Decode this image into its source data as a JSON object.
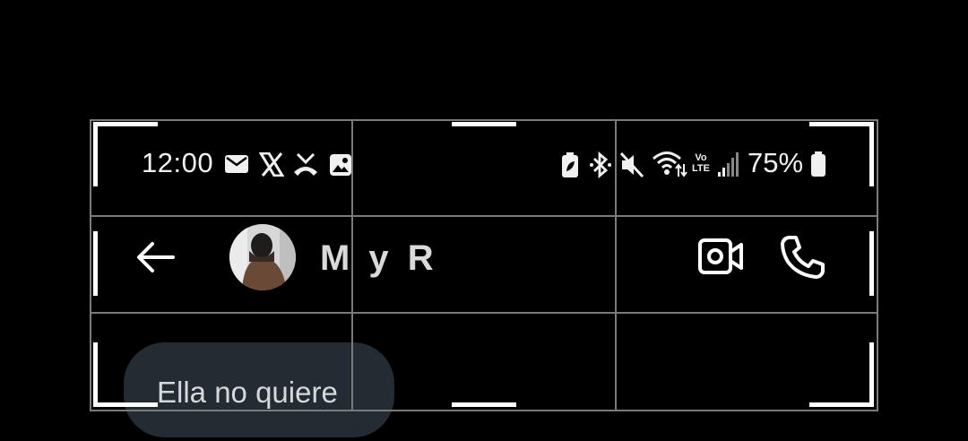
{
  "status_bar": {
    "time": "12:00",
    "battery": "75%",
    "left_icons": [
      "mail-icon",
      "x-logo-icon",
      "missed-call-icon",
      "image-icon"
    ],
    "right_icons": [
      "battery-saver-icon",
      "bluetooth-icon",
      "mute-icon",
      "wifi-icon",
      "volte-icon",
      "signal-icon",
      "battery-icon"
    ],
    "volte_top": "Vo",
    "volte_bottom": "LTE"
  },
  "header": {
    "contact_name": "M y R",
    "back_icon": "arrow-left-icon",
    "video_icon": "video-call-icon",
    "call_icon": "phone-icon"
  },
  "messages": [
    {
      "text": "Ella no quiere"
    }
  ],
  "colors": {
    "background": "#000000",
    "bubble": "#232b33",
    "grid": "#7a7a7a"
  }
}
